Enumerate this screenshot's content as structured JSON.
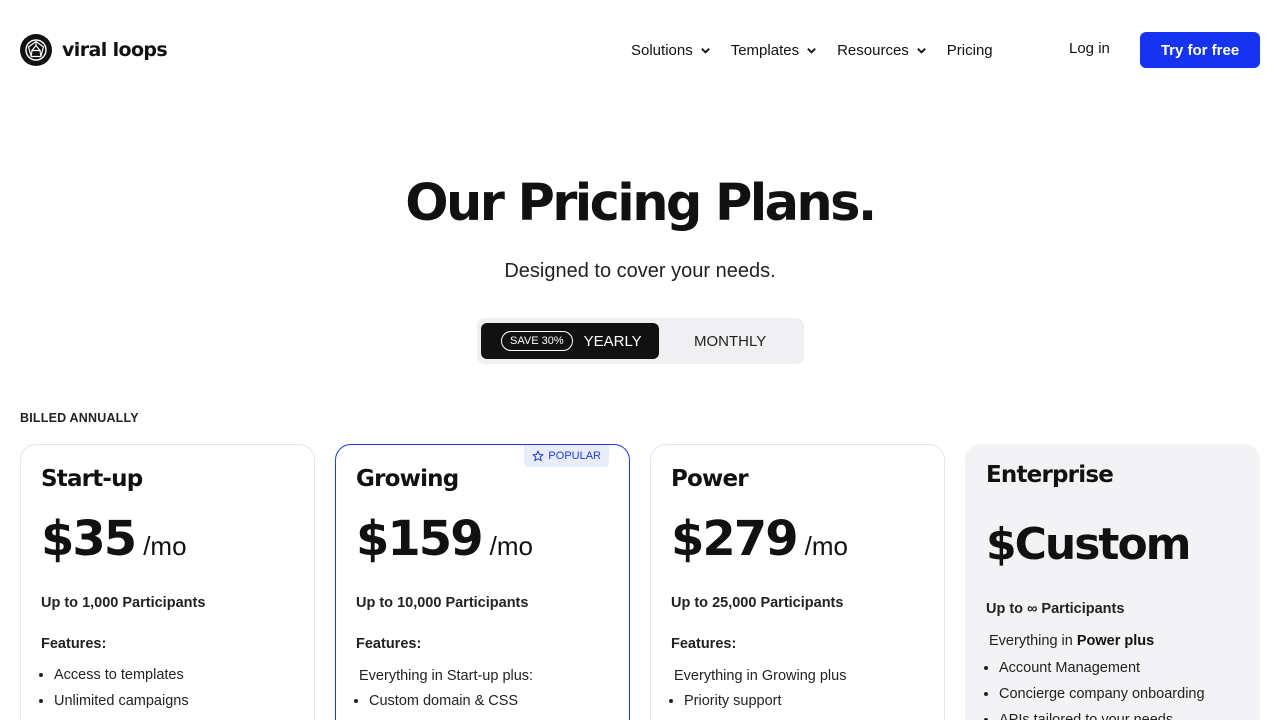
{
  "brand": {
    "name": "viral loops"
  },
  "nav": {
    "items": [
      {
        "label": "Solutions",
        "has_dropdown": true
      },
      {
        "label": "Templates",
        "has_dropdown": true
      },
      {
        "label": "Resources",
        "has_dropdown": true
      },
      {
        "label": "Pricing",
        "has_dropdown": false
      }
    ],
    "login": "Log in",
    "cta": "Try for free"
  },
  "hero": {
    "title": "Our Pricing Plans.",
    "subtitle": "Designed to cover your needs."
  },
  "billing_toggle": {
    "save_badge": "SAVE 30%",
    "yearly": "YEARLY",
    "monthly": "MONTHLY",
    "selected": "YEARLY"
  },
  "billing_note": "BILLED ANNUALLY",
  "plans": [
    {
      "name": "Start-up",
      "price": "$35",
      "period": "/mo",
      "participants": "Up to 1,000 Participants",
      "features_label": "Features:",
      "inherits": "",
      "features": [
        "Access to templates",
        "Unlimited campaigns"
      ]
    },
    {
      "name": "Growing",
      "badge": "POPULAR",
      "price": "$159",
      "period": "/mo",
      "participants": "Up to 10,000 Participants",
      "features_label": "Features:",
      "inherits": "Everything in Start-up plus:",
      "features": [
        "Custom domain & CSS"
      ]
    },
    {
      "name": "Power",
      "price": "$279",
      "period": "/mo",
      "participants": "Up to 25,000 Participants",
      "features_label": "Features:",
      "inherits": "Everything in Growing plus",
      "features": [
        "Priority support"
      ]
    },
    {
      "name": "Enterprise",
      "price": "$Custom",
      "participants": "Up to ∞ Participants",
      "inherits_prefix": "Everything in",
      "inherits_bold": "Power plus",
      "features": [
        "Account Management",
        "Concierge company onboarding",
        "APIs tailored to your needs"
      ]
    }
  ],
  "colors": {
    "accent": "#1634f0",
    "popular_border": "#1a3ce0",
    "enterprise_bg": "#f3f3f6",
    "toggle_active": "#111111"
  }
}
